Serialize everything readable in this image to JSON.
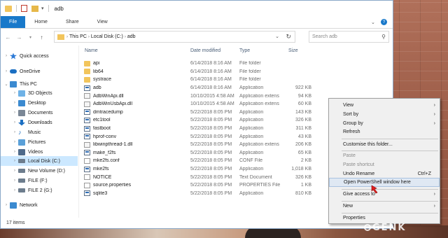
{
  "window": {
    "title": "adb"
  },
  "ribbon": {
    "tabs": [
      "File",
      "Home",
      "Share",
      "View"
    ]
  },
  "address": {
    "crumbs": [
      "This PC",
      "Local Disk (C:)",
      "adb"
    ],
    "search_placeholder": "Search adb"
  },
  "sidebar": {
    "items": [
      {
        "label": "Quick access",
        "icon": "star-icon",
        "color": "#2d7ad6"
      },
      {
        "label": "OneDrive",
        "icon": "cloud-icon",
        "color": "#1b6fc2"
      },
      {
        "label": "This PC",
        "icon": "computer-icon",
        "color": "#3b8ad0"
      },
      {
        "label": "3D Objects",
        "icon": "cube-icon",
        "color": "#6fb2e6"
      },
      {
        "label": "Desktop",
        "icon": "desktop-icon",
        "color": "#3b8ad0"
      },
      {
        "label": "Documents",
        "icon": "documents-icon",
        "color": "#7a8796"
      },
      {
        "label": "Downloads",
        "icon": "download-icon",
        "color": "#1b6fc2"
      },
      {
        "label": "Music",
        "icon": "music-icon",
        "color": "#1b6fc2"
      },
      {
        "label": "Pictures",
        "icon": "pictures-icon",
        "color": "#5aa0d8"
      },
      {
        "label": "Videos",
        "icon": "videos-icon",
        "color": "#4f6a8a"
      },
      {
        "label": "Local Disk (C:)",
        "icon": "drive-icon",
        "color": "#6d7d8d"
      },
      {
        "label": "New Volume (D:)",
        "icon": "drive-icon",
        "color": "#6d7d8d"
      },
      {
        "label": "FILE (F:)",
        "icon": "drive-icon",
        "color": "#6d7d8d"
      },
      {
        "label": "FILE 2 (G:)",
        "icon": "drive-icon",
        "color": "#6d7d8d"
      },
      {
        "label": "Network",
        "icon": "network-icon",
        "color": "#3b8ad0"
      }
    ]
  },
  "columns": {
    "name": "Name",
    "date": "Date modified",
    "type": "Type",
    "size": "Size"
  },
  "files": [
    {
      "name": "api",
      "date": "6/14/2018 8:16 AM",
      "type": "File folder",
      "size": "",
      "icon": "folder"
    },
    {
      "name": "lib64",
      "date": "6/14/2018 8:16 AM",
      "type": "File folder",
      "size": "",
      "icon": "folder"
    },
    {
      "name": "systrace",
      "date": "6/14/2018 8:16 AM",
      "type": "File folder",
      "size": "",
      "icon": "folder"
    },
    {
      "name": "adb",
      "date": "6/14/2018 8:16 AM",
      "type": "Application",
      "size": "922 KB",
      "icon": "app"
    },
    {
      "name": "AdbWinApi.dll",
      "date": "10/10/2015 4:58 AM",
      "type": "Application extens",
      "size": "94 KB",
      "icon": "dll"
    },
    {
      "name": "AdbWinUsbApi.dll",
      "date": "10/10/2015 4:58 AM",
      "type": "Application extens",
      "size": "60 KB",
      "icon": "dll"
    },
    {
      "name": "dmtracedump",
      "date": "5/22/2018 8:05 PM",
      "type": "Application",
      "size": "143 KB",
      "icon": "app"
    },
    {
      "name": "etc1tool",
      "date": "5/22/2018 8:05 PM",
      "type": "Application",
      "size": "326 KB",
      "icon": "app"
    },
    {
      "name": "fastboot",
      "date": "5/22/2018 8:05 PM",
      "type": "Application",
      "size": "311 KB",
      "icon": "app"
    },
    {
      "name": "hprof-conv",
      "date": "5/22/2018 8:05 PM",
      "type": "Application",
      "size": "43 KB",
      "icon": "app"
    },
    {
      "name": "libwinpthread-1.dll",
      "date": "5/22/2018 8:05 PM",
      "type": "Application extens",
      "size": "206 KB",
      "icon": "dll"
    },
    {
      "name": "make_f2fs",
      "date": "5/22/2018 8:05 PM",
      "type": "Application",
      "size": "65 KB",
      "icon": "app"
    },
    {
      "name": "mke2fs.conf",
      "date": "5/22/2018 8:05 PM",
      "type": "CONF File",
      "size": "2 KB",
      "icon": "doc"
    },
    {
      "name": "mke2fs",
      "date": "5/22/2018 8:05 PM",
      "type": "Application",
      "size": "1,018 KB",
      "icon": "app"
    },
    {
      "name": "NOTICE",
      "date": "5/22/2018 8:05 PM",
      "type": "Text Document",
      "size": "326 KB",
      "icon": "doc"
    },
    {
      "name": "source.properties",
      "date": "5/22/2018 8:05 PM",
      "type": "PROPERTIES File",
      "size": "1 KB",
      "icon": "doc"
    },
    {
      "name": "sqlite3",
      "date": "5/22/2018 8:05 PM",
      "type": "Application",
      "size": "810 KB",
      "icon": "app"
    }
  ],
  "status": {
    "items": "17 items"
  },
  "context_menu": {
    "view": "View",
    "sort_by": "Sort by",
    "group_by": "Group by",
    "refresh": "Refresh",
    "customise": "Customise this folder...",
    "paste": "Paste",
    "paste_shortcut": "Paste shortcut",
    "undo_rename": "Undo Rename",
    "undo_shortcut": "Ctrl+Z",
    "open_powershell": "Open PowerShell window here",
    "give_access": "Give access to",
    "new": "New",
    "properties": "Properties"
  },
  "watermark": {
    "text": "GENK"
  }
}
